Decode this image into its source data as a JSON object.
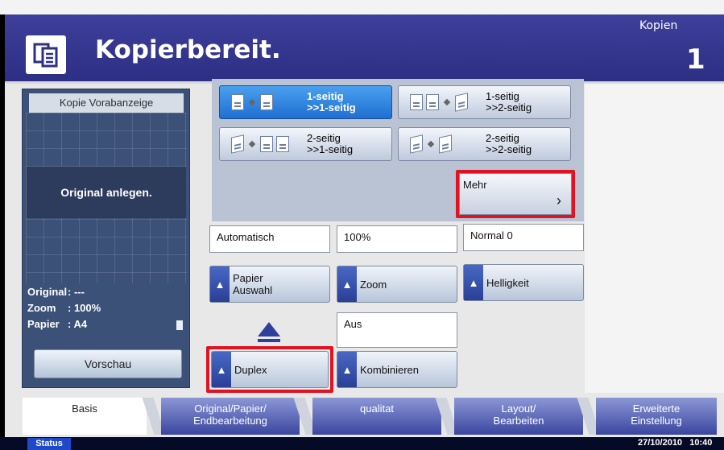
{
  "header": {
    "title": "Kopierbereit.",
    "copies_label": "Kopien",
    "copies_count": "1"
  },
  "preview": {
    "title": "Kopie Vorabanzeige",
    "message": "Original anlegen.",
    "info": [
      {
        "key": "Original",
        "value": ": ---"
      },
      {
        "key": "Zoom",
        "value": ": 100%"
      },
      {
        "key": "Papier",
        "value": ": A4"
      }
    ],
    "preview_button": "Vorschau"
  },
  "duplex_modes": [
    {
      "label": "1-seitig\n>>1-seitig",
      "selected": true
    },
    {
      "label": "1-seitig\n>>2-seitig",
      "selected": false
    },
    {
      "label": "2-seitig\n>>1-seitig",
      "selected": false
    },
    {
      "label": "2-seitig\n>>2-seitig",
      "selected": false
    }
  ],
  "more_button": {
    "label": "Mehr",
    "chevron": "chevron-right-icon"
  },
  "settings": {
    "paper": {
      "value": "Automatisch",
      "button": "Papier\nAuswahl"
    },
    "zoom": {
      "value": "100%",
      "button": "Zoom"
    },
    "density": {
      "value": "Normal 0",
      "button": "Helligkeit"
    },
    "combine": {
      "value": "Aus",
      "button": "Kombinieren"
    },
    "duplex": {
      "button": "Duplex"
    }
  },
  "tabs": [
    {
      "label": "Basis",
      "active": true
    },
    {
      "label": "Original/Papier/\nEndbearbeitung",
      "active": false
    },
    {
      "label": "qualitat",
      "active": false
    },
    {
      "label": "Layout/\nBearbeiten",
      "active": false
    },
    {
      "label": "Erweiterte\nEinstellung",
      "active": false
    }
  ],
  "statusbar": {
    "status_button": "Status",
    "date": "27/10/2010",
    "time": "10:40"
  },
  "colors": {
    "header": "#2d2f85",
    "selected_mode": "#1f6fd2",
    "highlight": "#e11222",
    "tab": "#3a469e"
  }
}
